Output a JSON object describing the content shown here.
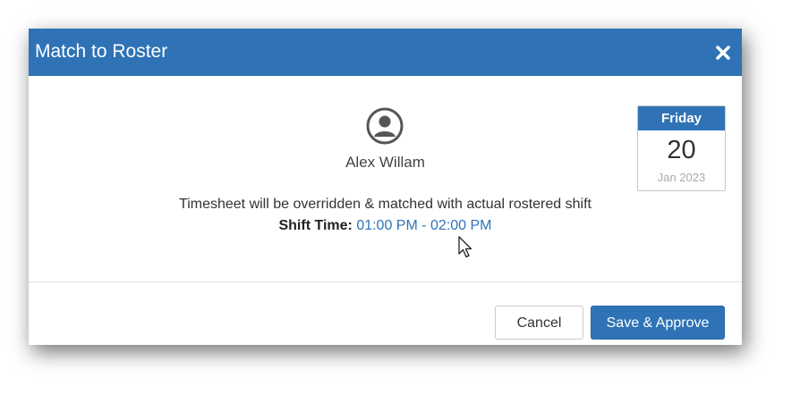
{
  "dialog": {
    "title": "Match to Roster",
    "close_icon": "close-icon"
  },
  "employee": {
    "name": "Alex Willam",
    "avatar_icon": "user-circle-icon"
  },
  "message": "Timesheet will be overridden & matched with actual rostered shift",
  "shift": {
    "label": "Shift Time:",
    "value": "01:00 PM - 02:00 PM"
  },
  "calendar": {
    "day": "Friday",
    "date": "20",
    "month_year": "Jan 2023"
  },
  "buttons": {
    "cancel": "Cancel",
    "save_approve": "Save & Approve"
  },
  "colors": {
    "primary": "#2f73b6",
    "header_text": "#ffffff"
  }
}
